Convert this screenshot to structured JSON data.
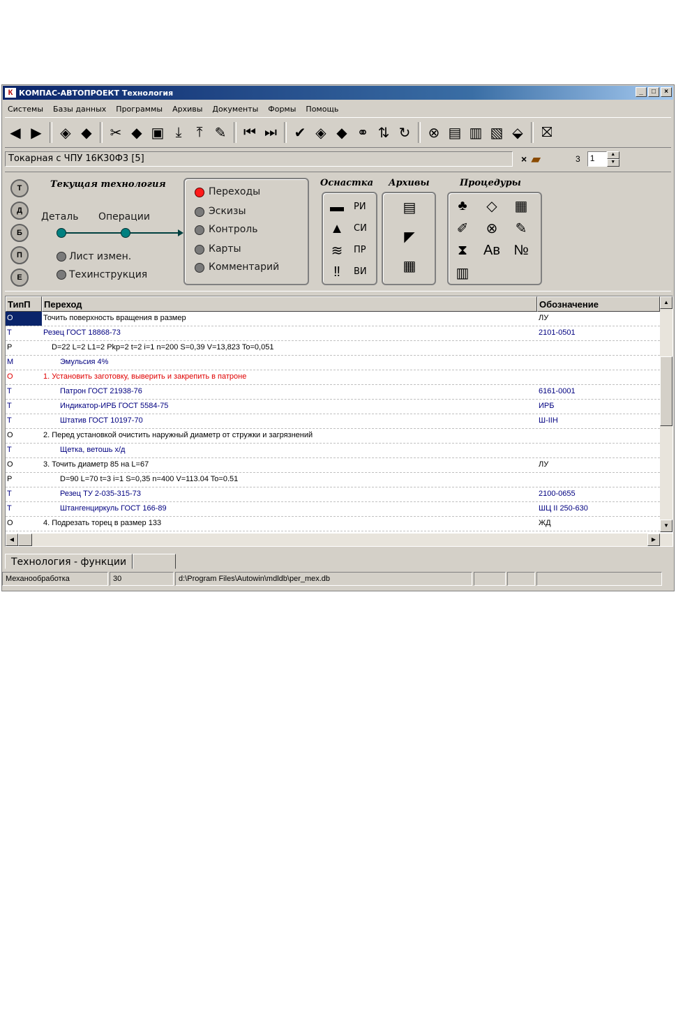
{
  "window": {
    "title": "КОМПАС-АВТОПРОЕКТ Технология",
    "logo": "К",
    "controls": [
      "_",
      "□",
      "×"
    ]
  },
  "menu": [
    "Системы",
    "Базы данных",
    "Программы",
    "Архивы",
    "Документы",
    "Формы",
    "Помощь"
  ],
  "toolbar": {
    "groups": [
      [
        "arrow-left-icon",
        "arrow-right-icon"
      ],
      [
        "stack-icon",
        "stack-alt-icon"
      ],
      [
        "cut-icon",
        "copy-icon",
        "paste-icon",
        "import-icon",
        "export-icon",
        "edit-icon"
      ],
      [
        "first-icon",
        "last-icon"
      ],
      [
        "check-icon",
        "db-add-icon",
        "db-remove-icon",
        "binoculars-icon",
        "sort-icon",
        "refresh-icon"
      ],
      [
        "stop-icon",
        "print-icon",
        "books-icon",
        "notes-icon",
        "eraser-icon"
      ],
      [
        "exit-icon"
      ]
    ],
    "glyphs": {
      "arrow-left-icon": "◀",
      "arrow-right-icon": "▶",
      "stack-icon": "◈",
      "stack-alt-icon": "◆",
      "cut-icon": "✂",
      "copy-icon": "◆",
      "paste-icon": "▣",
      "import-icon": "⤓",
      "export-icon": "⤒",
      "edit-icon": "✎",
      "first-icon": "⏮",
      "last-icon": "⏭",
      "check-icon": "✔",
      "db-add-icon": "◈",
      "db-remove-icon": "◆",
      "binoculars-icon": "⚭",
      "sort-icon": "⇅",
      "refresh-icon": "↻",
      "stop-icon": "⊗",
      "print-icon": "▤",
      "books-icon": "▥",
      "notes-icon": "▧",
      "eraser-icon": "⬙",
      "exit-icon": "⛝"
    }
  },
  "route": {
    "name": "Токарная с ЧПУ 16К30Ф3 [5]",
    "close": "×",
    "page_label": "3",
    "page_value": "1",
    "spin_up": "▲",
    "spin_down": "▼"
  },
  "side_buttons": [
    "Т",
    "Д",
    "Б",
    "П",
    "Е"
  ],
  "tech": {
    "title": "Текущая технология",
    "detail": "Деталь",
    "operations": "Операции",
    "change_sheet": "Лист измен.",
    "tech_instruction": "Техинструкция"
  },
  "views": [
    "Переходы",
    "Эскизы",
    "Контроль",
    "Карты",
    "Комментарий"
  ],
  "sections": {
    "osnastka": "Оснастка",
    "archives": "Архивы",
    "procedures": "Процедуры"
  },
  "osnastka_items": [
    {
      "label": "РИ",
      "icon": "ri-icon",
      "glyph": "▬"
    },
    {
      "label": "СИ",
      "icon": "si-icon",
      "glyph": "▲"
    },
    {
      "label": "ПР",
      "icon": "pr-icon",
      "glyph": "≋"
    },
    {
      "label": "ВИ",
      "icon": "vi-icon",
      "glyph": "‼"
    }
  ],
  "archive_items": [
    {
      "icon": "archive-save-icon",
      "glyph": "▤"
    },
    {
      "icon": "archive-open-icon",
      "glyph": "◤"
    },
    {
      "icon": "archive-load-icon",
      "glyph": "▦"
    }
  ],
  "procedure_items": [
    {
      "icon": "tree-icon",
      "glyph": "♣"
    },
    {
      "icon": "frame-icon",
      "glyph": "◇"
    },
    {
      "icon": "calculator-icon",
      "glyph": "▦"
    },
    {
      "icon": "brush-icon",
      "glyph": "✐"
    },
    {
      "icon": "alert-icon",
      "glyph": "⊗"
    },
    {
      "icon": "pencil-icon",
      "glyph": "✎"
    },
    {
      "icon": "hourglass-icon",
      "glyph": "⧗"
    },
    {
      "icon": "font-icon",
      "glyph": "Aв"
    },
    {
      "icon": "number-icon",
      "glyph": "№"
    },
    {
      "icon": "table-icon",
      "glyph": "▥"
    }
  ],
  "grid": {
    "columns": [
      "ТипП",
      "Переход",
      "Обозначение"
    ],
    "rows": [
      {
        "type": "О",
        "text": "Точить поверхность вращения в размер",
        "code": "ЛУ",
        "color": "#000000",
        "indent": 0,
        "selected": true
      },
      {
        "type": "Т",
        "text": "Резец   ГОСТ 18868-73",
        "code": "2101-0501",
        "color": "#000080",
        "indent": 0
      },
      {
        "type": "Р",
        "text": "D=22  L=2  L1=2  Pkp=2  t=2  i=1  n=200  S=0,39  V=13,823  To=0,051",
        "code": "",
        "color": "#000000",
        "indent": 1
      },
      {
        "type": "М",
        "text": "Эмульсия 4%",
        "code": "",
        "color": "#000080",
        "indent": 2
      },
      {
        "type": "О",
        "text": "1. Установить заготовку, выверить и закрепить в патроне",
        "code": "",
        "color": "#e00000",
        "indent": 0
      },
      {
        "type": "Т",
        "text": "Патрон    ГОСТ 21938-76",
        "code": "6161-0001",
        "color": "#000080",
        "indent": 2
      },
      {
        "type": "Т",
        "text": "Индикатор-ИРБ  ГОСТ 5584-75",
        "code": "ИРБ",
        "color": "#000080",
        "indent": 2
      },
      {
        "type": "Т",
        "text": "Штатив  ГОСТ 10197-70",
        "code": "Ш-IIН",
        "color": "#000080",
        "indent": 2
      },
      {
        "type": "О",
        "text": "2. Перед установкой очистить наружный диаметр от стружки и загрязнений",
        "code": "",
        "color": "#000000",
        "indent": 0
      },
      {
        "type": "Т",
        "text": "Щетка, ветошь х/д",
        "code": "",
        "color": "#000080",
        "indent": 2
      },
      {
        "type": "О",
        "text": "3. Точить диаметр 85 на L=67",
        "code": "ЛУ",
        "color": "#000000",
        "indent": 0
      },
      {
        "type": "Р",
        "text": "D=90   L=70   t=3   i=1   S=0,35   n=400   V=113.04   To=0.51",
        "code": "",
        "color": "#000000",
        "indent": 2
      },
      {
        "type": "Т",
        "text": "Резец        ТУ 2-035-315-73",
        "code": "2100-0655",
        "color": "#000080",
        "indent": 2
      },
      {
        "type": "Т",
        "text": "Штангенциркуль  ГОСТ 166-89",
        "code": "ШЦ II 250-630",
        "color": "#000080",
        "indent": 2
      },
      {
        "type": "О",
        "text": "4. Подрезать торец в размер 133",
        "code": "ЖД",
        "color": "#000000",
        "indent": 0
      }
    ]
  },
  "scroll": {
    "up": "▲",
    "down": "▼",
    "left": "◀",
    "right": "▶"
  },
  "tabs": [
    "Технология - функции",
    ""
  ],
  "status": [
    "Механообработка",
    "30",
    "d:\\Program Files\\Autowin\\mdldb\\per_mex.db",
    "",
    "",
    ""
  ]
}
